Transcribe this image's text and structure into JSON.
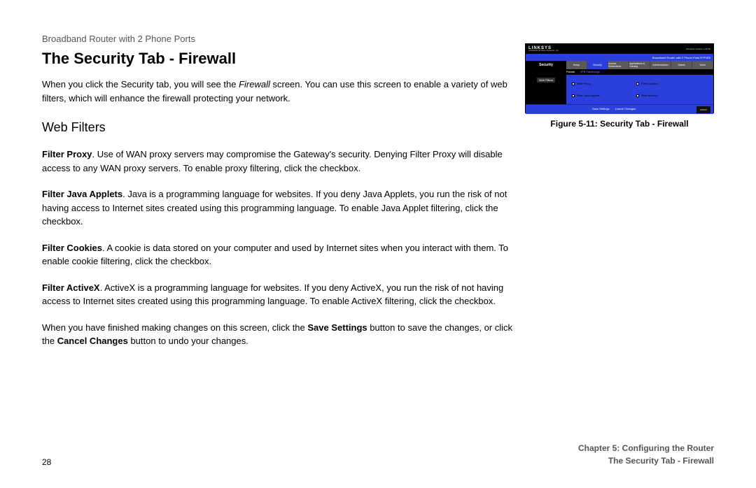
{
  "header": {
    "product": "Broadband Router with 2 Phone Ports"
  },
  "title": "The Security Tab - Firewall",
  "intro": {
    "pre": "When you click the Security tab, you will see the ",
    "em": "Firewall",
    "post": " screen. You can use this screen to enable a variety of web filters, which will enhance the firewall protecting your network."
  },
  "subhead": "Web Filters",
  "paras": {
    "proxy_head": "Filter Proxy",
    "proxy_body": ". Use of WAN proxy servers may compromise the Gateway's security. Denying Filter Proxy will disable access to any WAN proxy servers. To enable proxy filtering, click the checkbox.",
    "java_head": "Filter Java Applets",
    "java_body": ". Java is a programming language for websites. If you deny Java Applets, you run the risk of not having access to Internet sites created using this programming language. To enable Java Applet filtering, click the checkbox.",
    "cookies_head": "Filter Cookies",
    "cookies_body": ". A cookie is data stored on your computer and used by Internet sites when you interact with them. To enable cookie filtering, click the checkbox.",
    "activex_head": "Filter ActiveX",
    "activex_body": ". ActiveX is a programming language for websites. If you deny ActiveX, you run the risk of not having access to Internet sites created using this programming language. To enable ActiveX filtering, click the checkbox.",
    "save_pre": "When you have finished making changes on this screen, click the ",
    "save_b1": "Save Settings",
    "save_mid": " button to save the changes, or click the ",
    "save_b2": "Cancel Changes",
    "save_post": " button to undo your changes."
  },
  "figure": {
    "caption": "Figure 5-11: Security Tab - Firewall",
    "brand": "LINKSYS",
    "brand_sub": "A Division of Cisco Systems, Inc.",
    "blue_right": "Broadband Router with 2 Phone Ports    RTP300",
    "section_label": "Security",
    "tabs": [
      "Setup",
      "Security",
      "Access Restrictions",
      "Applications & Gaming",
      "Administration",
      "Status",
      "Voice"
    ],
    "subtabs": [
      "Firewall",
      "VPN Passthrough"
    ],
    "side_label": "Web Filters",
    "checks": [
      "Filter Proxy",
      "Filter Cookies",
      "Filter Java Applets",
      "Filter ActiveX"
    ],
    "buttons": [
      "Save Settings",
      "Cancel Changes"
    ],
    "cisco": "CISCO"
  },
  "footer": {
    "page": "28",
    "chapter": "Chapter 5: Configuring the Router",
    "section": "The Security Tab - Firewall"
  }
}
